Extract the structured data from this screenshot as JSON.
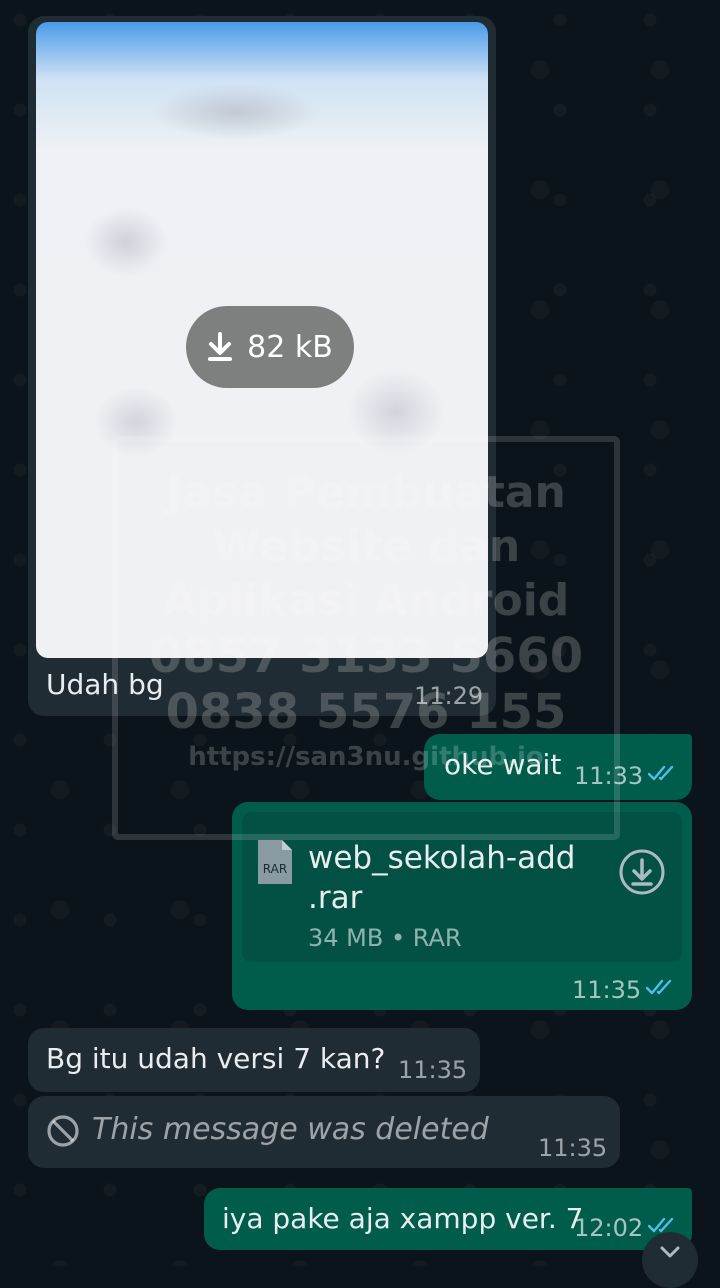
{
  "messages": {
    "image": {
      "download_size": "82 kB",
      "caption": "Udah bg",
      "time": "11:29"
    },
    "oke": {
      "text": "oke wait",
      "time": "11:33"
    },
    "file": {
      "name": "web_sekolah-add\n.rar",
      "type_badge": "RAR",
      "meta": "34 MB • RAR",
      "time": "11:35"
    },
    "question": {
      "text": "Bg itu udah versi 7 kan?",
      "time": "11:35"
    },
    "deleted": {
      "text": "This message was deleted",
      "time": "11:35"
    },
    "iya": {
      "text": "iya pake aja xampp ver. 7",
      "time": "12:02"
    }
  },
  "watermark": {
    "line1": "Jasa Pembuatan",
    "line2": "Website dan",
    "line3": "Aplikasi Android",
    "phone1": "0857 3133 5660",
    "phone2": "0838 5576 155",
    "url": "https://san3nu.github.io"
  },
  "colors": {
    "background": "#0b141a",
    "incoming_bubble": "#202c33",
    "outgoing_bubble": "#005c4b",
    "read_ticks": "#53bdeb"
  },
  "icons": [
    "download-icon",
    "file-rar-icon",
    "download-circle-icon",
    "blocked-icon",
    "double-check-icon",
    "chevron-down-icon"
  ]
}
